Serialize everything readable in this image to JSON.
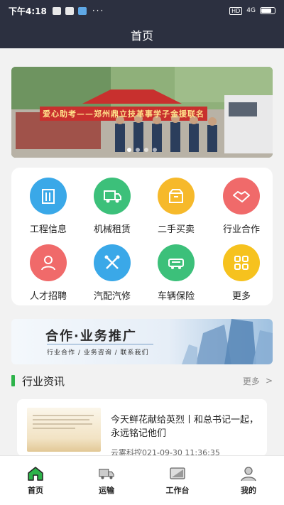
{
  "status_bar": {
    "time": "下午4:18",
    "network": "4G",
    "hd": "HD",
    "more": "···"
  },
  "header": {
    "title": "首页"
  },
  "banner": {
    "caption": "爱心助考——郑州鼎立技革事学子金援联名",
    "slides": 4,
    "active_slide": 1
  },
  "services": [
    {
      "label": "工程信息",
      "icon": "building-icon",
      "color": "#3aa8e8"
    },
    {
      "label": "机械租赁",
      "icon": "truck-rent-icon",
      "color": "#3cc07a"
    },
    {
      "label": "二手买卖",
      "icon": "box-icon",
      "color": "#f6b92b"
    },
    {
      "label": "行业合作",
      "icon": "handshake-icon",
      "color": "#f06a6a"
    },
    {
      "label": "人才招聘",
      "icon": "person-icon",
      "color": "#f06a6a"
    },
    {
      "label": "汽配汽修",
      "icon": "tools-icon",
      "color": "#3aa8e8"
    },
    {
      "label": "车辆保险",
      "icon": "car-insurance-icon",
      "color": "#3cc07a"
    },
    {
      "label": "更多",
      "icon": "grid-icon",
      "color": "#f6c21e"
    }
  ],
  "promo": {
    "title": "合作·业务推广",
    "subtitle": "行业合作 / 业务咨询 / 联系我们"
  },
  "news_section": {
    "title": "行业资讯",
    "more": "更多",
    "accent": "#2db34a"
  },
  "news": [
    {
      "headline": "今天鲜花献给英烈丨和总书记一起，永远铭记他们",
      "meta": "云雾科控021-09-30 11:36:35"
    }
  ],
  "tabbar": [
    {
      "label": "首页",
      "icon": "home-icon"
    },
    {
      "label": "运输",
      "icon": "transport-icon"
    },
    {
      "label": "工作台",
      "icon": "workbench-icon"
    },
    {
      "label": "我的",
      "icon": "profile-icon"
    }
  ]
}
